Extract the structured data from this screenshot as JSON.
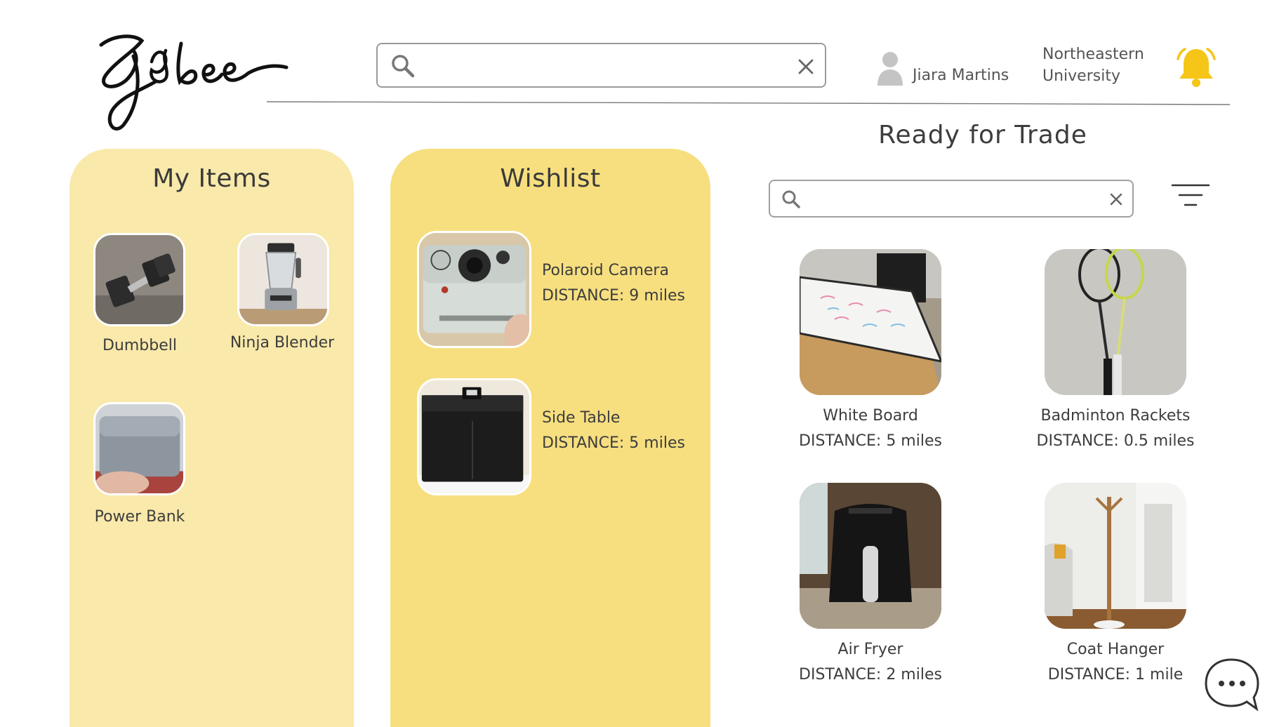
{
  "header": {
    "logo_text": "Gigbee",
    "search": {
      "value": "",
      "placeholder": ""
    },
    "user_name": "Jiara Martins",
    "university": "Northeastern University"
  },
  "icons": {
    "search": "search-icon",
    "clear": "close-icon",
    "user": "user-avatar-icon",
    "bell": "bell-icon",
    "filter": "filter-icon",
    "chat": "chat-bubble-icon"
  },
  "colors": {
    "my_items_panel": "#f9e9aa",
    "wishlist_panel": "#f7df80",
    "bell": "#f5c518"
  },
  "my_items": {
    "title": "My Items",
    "items": [
      {
        "label": "Dumbbell"
      },
      {
        "label": "Ninja Blender"
      },
      {
        "label": "Power Bank"
      }
    ]
  },
  "wishlist": {
    "title": "Wishlist",
    "items": [
      {
        "name": "Polaroid Camera",
        "distance": "DISTANCE: 9 miles"
      },
      {
        "name": "Side Table",
        "distance": "DISTANCE: 5 miles"
      }
    ]
  },
  "trade": {
    "title": "Ready for Trade",
    "search": {
      "value": "",
      "placeholder": ""
    },
    "items": [
      {
        "name": "White Board",
        "distance": "DISTANCE: 5 miles"
      },
      {
        "name": "Badminton Rackets",
        "distance": "DISTANCE: 0.5 miles"
      },
      {
        "name": "Air Fryer",
        "distance": "DISTANCE: 2 miles"
      },
      {
        "name": "Coat Hanger",
        "distance": "DISTANCE: 1 mile"
      }
    ]
  }
}
